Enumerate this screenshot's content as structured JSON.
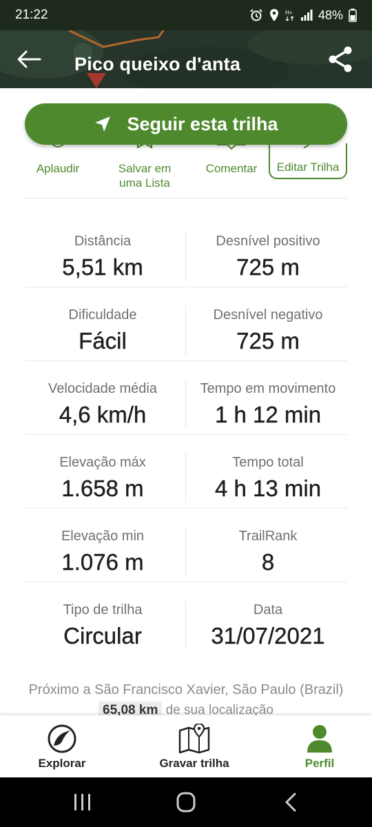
{
  "status_bar": {
    "time": "21:22",
    "battery": "48%"
  },
  "header": {
    "title": "Pico queixo d'anta"
  },
  "follow_button": {
    "label": "Seguir esta trilha"
  },
  "actions": {
    "applaud": "Aplaudir",
    "save_line1": "Salvar em",
    "save_line2": "uma Lista",
    "comment": "Comentar",
    "edit": "Editar Trilha"
  },
  "stats": [
    {
      "left_label": "Distância",
      "left_value": "5,51 km",
      "right_label": "Desnível positivo",
      "right_value": "725 m"
    },
    {
      "left_label": "Dificuldade",
      "left_value": "Fácil",
      "right_label": "Desnível negativo",
      "right_value": "725 m"
    },
    {
      "left_label": "Velocidade média",
      "left_value": "4,6 km/h",
      "right_label": "Tempo em movimento",
      "right_value": "1 h 12 min"
    },
    {
      "left_label": "Elevação máx",
      "left_value": "1.658 m",
      "right_label": "Tempo total",
      "right_value": "4 h 13 min"
    },
    {
      "left_label": "Elevação min",
      "left_value": "1.076 m",
      "right_label": "TrailRank",
      "right_value": "8"
    },
    {
      "left_label": "Tipo de trilha",
      "left_value": "Circular",
      "right_label": "Data",
      "right_value": "31/07/2021"
    }
  ],
  "location": {
    "near": "Próximo a São Francisco Xavier, São Paulo (Brazil)",
    "distance": "65,08 km",
    "distance_suffix": "de sua localização"
  },
  "bottom_nav": {
    "explore": "Explorar",
    "record": "Gravar trilha",
    "profile": "Perfil"
  },
  "colors": {
    "brand_green": "#4e8a2d",
    "status_bar": "#1d2a1c"
  }
}
